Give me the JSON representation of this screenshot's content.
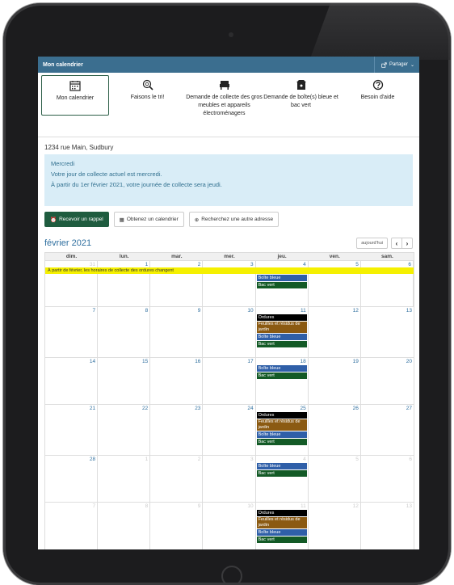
{
  "app": {
    "title": "Mon calendrier",
    "share_label": "Partager"
  },
  "nav": [
    {
      "label": "Mon calendrier",
      "icon": "calendar-icon"
    },
    {
      "label": "Faisons le tri!",
      "icon": "recycle-search-icon"
    },
    {
      "label": "Demande de collecte des gros meubles et appareils électroménagers",
      "icon": "armchair-icon"
    },
    {
      "label": "Demande de boîte(s) bleue et bac vert",
      "icon": "bin-icon"
    },
    {
      "label": "Besoin d'aide",
      "icon": "help-icon"
    }
  ],
  "address": "1234 rue Main, Sudbury",
  "info": {
    "day": "Mercredi",
    "line1": "Votre jour de collecte actuel est mercredi.",
    "line2": "À partir du 1er février 2021, votre journée de collecte sera jeudi."
  },
  "buttons": {
    "reminder": "Recevoir un rappel",
    "get_calendar": "Obtenez un calendrier",
    "search_address": "Recherchez une autre adresse"
  },
  "calendar": {
    "month": "février 2021",
    "today_label": "aujourd'hui",
    "weekdays": [
      "dim.",
      "lun.",
      "mar.",
      "mer.",
      "jeu.",
      "ven.",
      "sam."
    ],
    "banner": "À partir de février, les horaires de collecte des ordures changent",
    "weeks": [
      {
        "days": [
          "31",
          "1",
          "2",
          "3",
          "4",
          "5",
          "6"
        ],
        "other": [
          0
        ]
      },
      {
        "days": [
          "7",
          "8",
          "9",
          "10",
          "11",
          "12",
          "13"
        ],
        "other": []
      },
      {
        "days": [
          "14",
          "15",
          "16",
          "17",
          "18",
          "19",
          "20"
        ],
        "other": []
      },
      {
        "days": [
          "21",
          "22",
          "23",
          "24",
          "25",
          "26",
          "27"
        ],
        "other": []
      },
      {
        "days": [
          "28",
          "1",
          "2",
          "3",
          "4",
          "5",
          "6"
        ],
        "other": [
          1,
          2,
          3,
          4,
          5,
          6
        ]
      },
      {
        "days": [
          "7",
          "8",
          "9",
          "10",
          "11",
          "12",
          "13"
        ],
        "other": [
          0,
          1,
          2,
          3,
          4,
          5,
          6
        ]
      }
    ],
    "event_labels": {
      "ordures": "Ordures",
      "feuilles": "Feuilles et résidus de jardin",
      "bleue": "Boîte bleue",
      "vert": "Bac vert"
    }
  },
  "colors": {
    "appbar": "#3b6e8f",
    "primary_button": "#1f5c3f",
    "ordures": "#000000",
    "feuilles": "#8b5a12",
    "bleue": "#2f5fa8",
    "vert": "#135a26",
    "banner": "#f5f000"
  }
}
